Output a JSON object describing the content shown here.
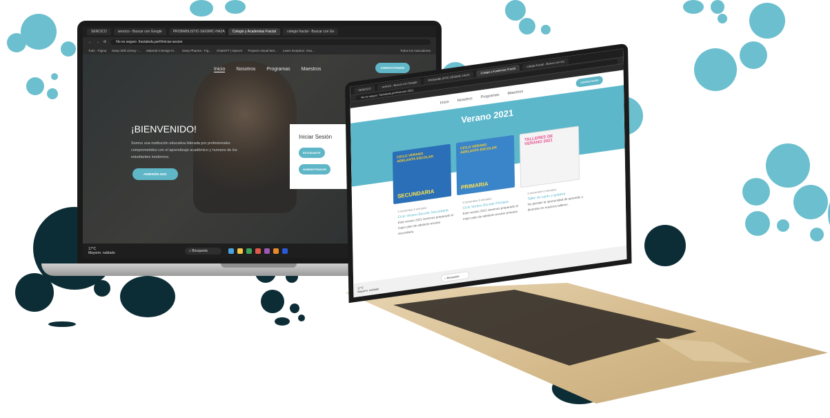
{
  "laptop_left": {
    "tabs": [
      "SENCICO",
      "sencico - Buscar con Google",
      "PROBABILISTIC-SEISMIC-HAZA",
      "Colegio y Academias Fractal",
      "colegio fractal - Buscar con Go"
    ],
    "address": "fractaledu.pe/#/iniciar-sesion",
    "address_prefix": "No es seguro",
    "bookmarks": [
      "Todo - Figma",
      "Deep Skill Library -...",
      "Material 3 Design Ki...",
      "Deep Pharma - Fig...",
      "ChatGPT | OpenAI",
      "Projects Visual Wor...",
      "Learn Inception: Visu..."
    ],
    "bookmarks_right": "Todos los marcadores",
    "nav": [
      "Inicio",
      "Nosotros",
      "Programas",
      "Maestros"
    ],
    "contact_btn": "CONTACTANOS",
    "heading": "¡BIENVENIDO!",
    "description": "Somos una institución educativa liderada por profesionales comprometidos con el aprendizaje académico y humano de los estudiantes modernos.",
    "admission_btn": "ADMISIÓN 2021",
    "login_title": "Iniciar Sesión",
    "student_btn": "ESTUDIANTE",
    "admin_btn": "ADMINISTRADOR",
    "weather_temp": "17°C",
    "weather_desc": "Mayorm. nublado",
    "search_label": "Búsqueda"
  },
  "laptop_right": {
    "tabs": [
      "SENCICO",
      "sencico - Buscar con Google",
      "PROBABILISTIC-SEISMIC-HAZA",
      "Colegio y Academias Fractal",
      "colegio fractal - Buscar con Go"
    ],
    "address": "fractaledu.pe/#/verano-2021",
    "address_prefix": "No es seguro",
    "nav": [
      "Inicio",
      "Nosotros",
      "Programas",
      "Maestros"
    ],
    "contact_btn": "CONTACTANOS",
    "banner_title": "Verano 2021",
    "cards": [
      {
        "top": "CICLO VERANO ADELANTA ESCOLAR",
        "label": "SECUNDARIA"
      },
      {
        "top": "CICLO VERANO ADELANTA ESCOLAR",
        "label": "PRIMARIA"
      },
      {
        "top": "TALLERES DE VERANO 2021",
        "label": ""
      }
    ],
    "posts": [
      {
        "date": "3 noviembre 0 entradas",
        "title": "Ciclo Verano Escolar Secundaria",
        "desc": "Este verano 2021 tenemos preparado el mejor plan de adelanto escolar secundaria."
      },
      {
        "date": "3 noviembre 0 entradas",
        "title": "Ciclo Verano Escolar Primaria",
        "desc": "Este verano 2021 tenemos preparado el mejor plan de adelanto escolar primaria."
      },
      {
        "date": "3 noviembre 0 entradas",
        "title": "Taller de canto y guitarra",
        "desc": "No pierdas la oportunidad de aprender y divertirte en nuestros talleres."
      }
    ],
    "weather_temp": "17°C",
    "weather_desc": "Mayorm. nublado",
    "search_label": "Búsqueda"
  },
  "colors": {
    "accent": "#5fb6c7",
    "navy": "#0d2d36",
    "teal_dot": "#6cbfce"
  }
}
